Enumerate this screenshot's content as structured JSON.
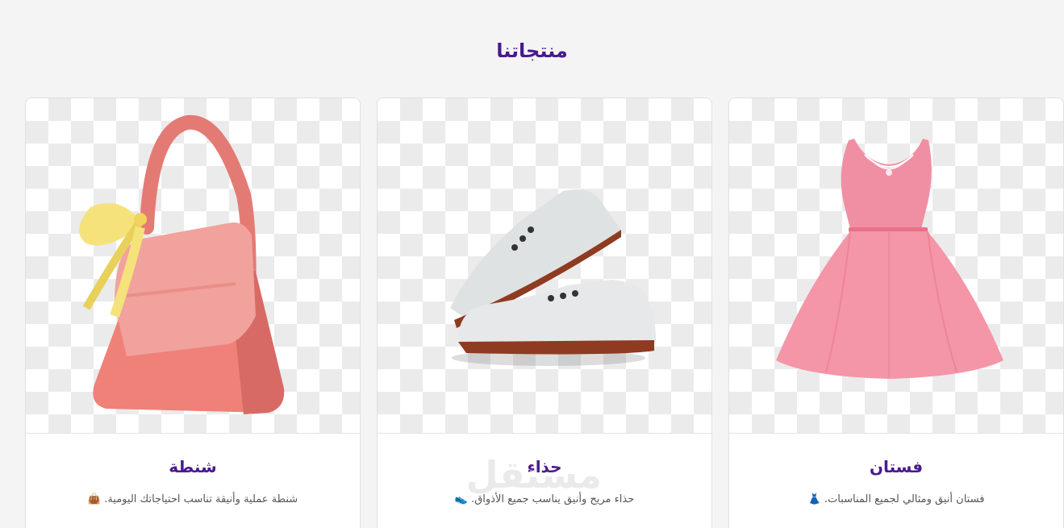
{
  "section": {
    "title": "منتجاتنا"
  },
  "products": [
    {
      "title": "فستان",
      "description": "فستان أنيق ومثالي لجميع المناسبات.",
      "emoji": "👗",
      "image_icon": "dress-icon"
    },
    {
      "title": "حذاء",
      "description": "حذاء مريح وأنيق يناسب جميع الأذواق.",
      "emoji": "👟",
      "image_icon": "sneakers-icon"
    },
    {
      "title": "شنطة",
      "description": "شنطة عملية وأنيقة تناسب احتياجاتك اليومية.",
      "emoji": "👜",
      "image_icon": "handbag-icon"
    }
  ],
  "watermark": {
    "text": "مستقل"
  },
  "colors": {
    "title": "#4a1a8c",
    "background": "#f4f4f4",
    "card": "#ffffff"
  }
}
